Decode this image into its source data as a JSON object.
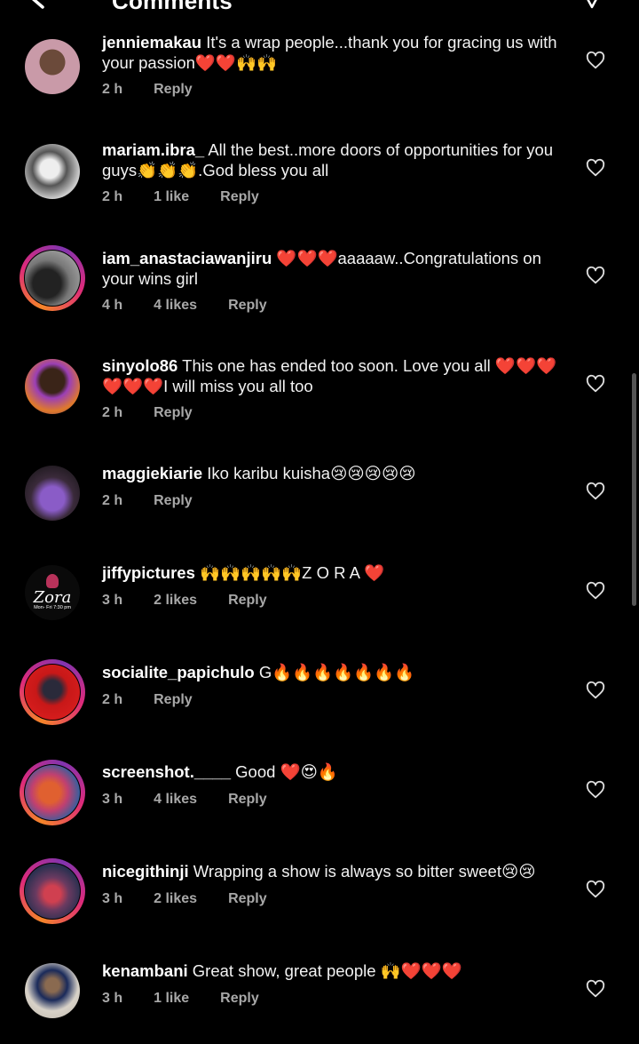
{
  "header": {
    "title": "Comments"
  },
  "comments": [
    {
      "username": "jenniemakau",
      "text": "It's a wrap people...thank you for gracing us with your passion❤️❤️🙌🙌",
      "time": "2 h",
      "likes": "",
      "reply": "Reply"
    },
    {
      "username": "mariam.ibra_",
      "text": "All the best..more doors  of opportunities  for you  guys👏👏👏.God bless  you  all",
      "time": "2 h",
      "likes": "1 like",
      "reply": "Reply"
    },
    {
      "username": "iam_anastaciawanjiru",
      "text": "❤️❤️❤️aaaaaw..Congratulations on your wins girl",
      "time": "4 h",
      "likes": "4 likes",
      "reply": "Reply"
    },
    {
      "username": "sinyolo86",
      "text": "This one has ended too soon. Love you all ❤️❤️❤️❤️❤️❤️I will miss you all too",
      "time": "2 h",
      "likes": "",
      "reply": "Reply"
    },
    {
      "username": "maggiekiarie",
      "text": "Iko karibu kuisha😢😢😢😢😢",
      "time": "2 h",
      "likes": "",
      "reply": "Reply"
    },
    {
      "username": "jiffypictures",
      "text": "🙌🙌🙌🙌🙌Z O R A ❤️",
      "time": "3 h",
      "likes": "2 likes",
      "reply": "Reply"
    },
    {
      "username": "socialite_papichulo",
      "text": "G🔥🔥🔥🔥🔥🔥🔥",
      "time": "2 h",
      "likes": "",
      "reply": "Reply"
    },
    {
      "username": "screenshot.____",
      "text": "Good ❤️😍🔥",
      "time": "3 h",
      "likes": "4 likes",
      "reply": "Reply"
    },
    {
      "username": "nicegithinji",
      "text": "Wrapping a show is always so bitter sweet😢😢",
      "time": "3 h",
      "likes": "2 likes",
      "reply": "Reply"
    },
    {
      "username": "kenambani",
      "text": "Great show, great people 🙌❤️❤️❤️",
      "time": "3 h",
      "likes": "1 like",
      "reply": "Reply"
    }
  ],
  "avatar_badge": {
    "brand": "Zora",
    "schedule": "Mon- Fri 7:30 pm"
  },
  "colors": {
    "background": "#000000",
    "meta_text": "#a8a8a8",
    "ring": "#dd2a7b"
  }
}
